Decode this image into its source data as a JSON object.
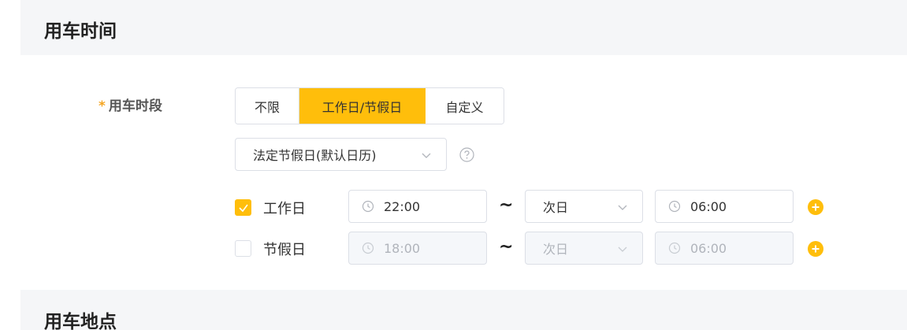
{
  "sections": {
    "time_title": "用车时间",
    "location_title": "用车地点"
  },
  "period": {
    "required_mark": "*",
    "label": "用车时段",
    "options": [
      "不限",
      "工作日/节假日",
      "自定义"
    ],
    "selected_index": 1
  },
  "calendar": {
    "value": "法定节假日(默认日历)"
  },
  "workday": {
    "checked": true,
    "label": "工作日",
    "start": "22:00",
    "separator": "~",
    "day": "次日",
    "end": "06:00"
  },
  "holiday": {
    "checked": false,
    "label": "节假日",
    "start": "18:00",
    "separator": "~",
    "day": "次日",
    "end": "06:00"
  },
  "colors": {
    "accent": "#ffbe0b",
    "header_bg": "#f5f6f8",
    "required": "#f5a623"
  },
  "icons": [
    "clock-icon",
    "chevron-down-icon",
    "help-icon",
    "check-icon",
    "plus-circle-icon"
  ]
}
